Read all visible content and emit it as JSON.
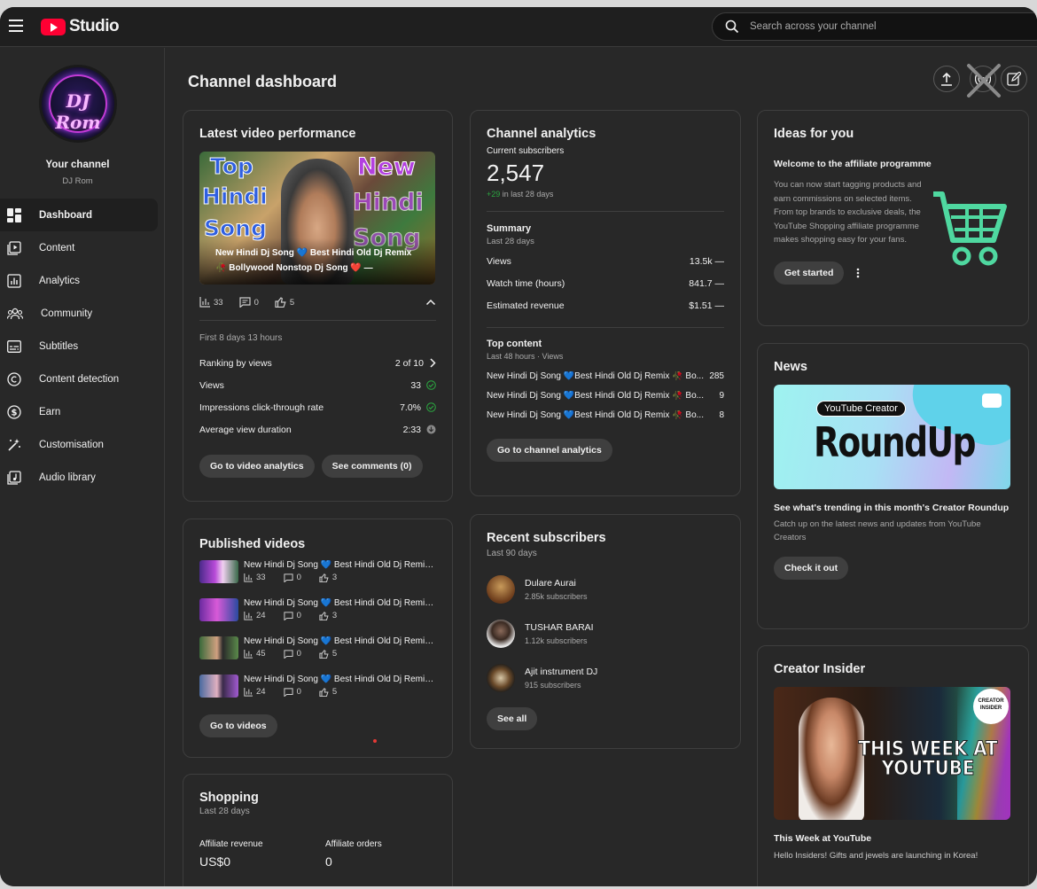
{
  "app": {
    "brand": "Studio",
    "search_placeholder": "Search across your channel"
  },
  "sidebar": {
    "channel_title": "Your channel",
    "channel_name": "DJ Rom",
    "avatar_text": "DJ Rom",
    "items": [
      {
        "label": "Dashboard",
        "icon": "dashboard-icon"
      },
      {
        "label": "Content",
        "icon": "content-icon"
      },
      {
        "label": "Analytics",
        "icon": "analytics-icon"
      },
      {
        "label": "Community",
        "icon": "community-icon"
      },
      {
        "label": "Subtitles",
        "icon": "subtitles-icon"
      },
      {
        "label": "Content detection",
        "icon": "copyright-icon"
      },
      {
        "label": "Earn",
        "icon": "dollar-icon"
      },
      {
        "label": "Customisation",
        "icon": "magic-wand-icon"
      },
      {
        "label": "Audio library",
        "icon": "audio-library-icon"
      }
    ]
  },
  "main": {
    "title": "Channel dashboard",
    "latest": {
      "title": "Latest video performance",
      "thumb_words": {
        "left1": "Top",
        "left2": "Hindi",
        "left3": "Song",
        "right1": "New",
        "right2": "Hindi",
        "right3": "Song"
      },
      "video_title": "New Hindi Dj Song 💙 Best Hindi Old Dj Remix 🥀 Bollywood Nonstop Dj Song ❤️ —",
      "stats": {
        "views": "33",
        "comments": "0",
        "likes": "5"
      },
      "period": "First 8 days 13 hours",
      "rows": [
        {
          "label": "Ranking by views",
          "value": "2 of 10"
        },
        {
          "label": "Views",
          "value": "33"
        },
        {
          "label": "Impressions click-through rate",
          "value": "7.0%"
        },
        {
          "label": "Average view duration",
          "value": "2:33"
        }
      ],
      "btn_analytics": "Go to video analytics",
      "btn_comments": "See comments (0)"
    },
    "published": {
      "title": "Published videos",
      "items": [
        {
          "title": "New Hindi Dj Song 💙 Best Hindi Old Dj Remix ...",
          "views": "33",
          "comments": "0",
          "likes": "3"
        },
        {
          "title": "New Hindi Dj Song 💙 Best Hindi Old Dj Remix ...",
          "views": "24",
          "comments": "0",
          "likes": "3"
        },
        {
          "title": "New Hindi Dj Song 💙 Best Hindi Old Dj Remix ...",
          "views": "45",
          "comments": "0",
          "likes": "5"
        },
        {
          "title": "New Hindi Dj Song 💙 Best Hindi Old Dj Remix ...",
          "views": "24",
          "comments": "0",
          "likes": "5"
        }
      ],
      "btn": "Go to videos"
    },
    "shopping": {
      "title": "Shopping",
      "period": "Last 28 days",
      "rev_label": "Affiliate revenue",
      "rev_value": "US$0",
      "orders_label": "Affiliate orders",
      "orders_value": "0"
    },
    "analytics": {
      "title": "Channel analytics",
      "subs_label": "Current subscribers",
      "subs_value": "2,547",
      "subs_delta": "+29",
      "subs_delta_period": "in last 28 days",
      "summary_title": "Summary",
      "summary_period": "Last 28 days",
      "summary_rows": [
        {
          "label": "Views",
          "value": "13.5k",
          "trend": "—"
        },
        {
          "label": "Watch time (hours)",
          "value": "841.7",
          "trend": "—"
        },
        {
          "label": "Estimated revenue",
          "value": "$1.51",
          "trend": "—"
        }
      ],
      "top_title": "Top content",
      "top_period": "Last 48 hours · Views",
      "top_rows": [
        {
          "title": "New Hindi Dj Song 💙Best Hindi Old Dj Remix 🥀 Bo...",
          "value": "285"
        },
        {
          "title": "New Hindi Dj Song 💙Best Hindi Old Dj Remix 🥀 Bo...",
          "value": "9"
        },
        {
          "title": "New Hindi Dj Song 💙Best Hindi Old Dj Remix 🥀 Bo...",
          "value": "8"
        }
      ],
      "btn": "Go to channel analytics"
    },
    "recent": {
      "title": "Recent subscribers",
      "period": "Last 90 days",
      "items": [
        {
          "name": "Dulare Aurai",
          "subs": "2.85k subscribers"
        },
        {
          "name": "TUSHAR BARAI",
          "subs": "1.12k subscribers"
        },
        {
          "name": "Ajit instrument DJ",
          "subs": "915 subscribers"
        }
      ],
      "btn": "See all"
    },
    "ideas": {
      "title": "Ideas for you",
      "subtitle": "Welcome to the affiliate programme",
      "body": "You can now start tagging products and earn commissions on selected items. From top brands to exclusive deals, the YouTube Shopping affiliate programme makes shopping easy for your fans.",
      "btn": "Get started"
    },
    "news": {
      "title": "News",
      "banner_small": "YouTube Creator",
      "banner_big": "RoundUp",
      "headline": "See what's trending in this month's Creator Roundup",
      "body": "Catch up on the latest news and updates from YouTube Creators",
      "btn": "Check it out"
    },
    "insider": {
      "title": "Creator Insider",
      "thumb_text": "THIS WEEK AT YOUTUBE",
      "badge": "CREATOR INSIDER",
      "headline": "This Week at YouTube",
      "body": "Hello Insiders! Gifts and jewels are launching in Korea!"
    }
  }
}
